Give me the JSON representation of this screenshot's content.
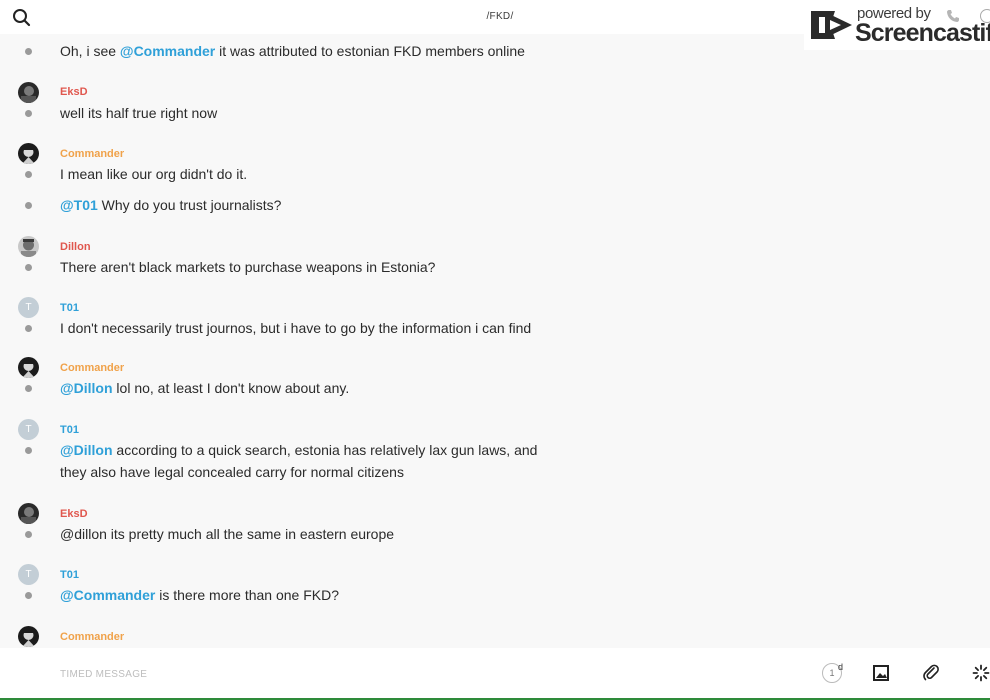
{
  "header": {
    "channel": "/FKD/",
    "search_icon": "search-icon"
  },
  "watermark": {
    "small": "powered by",
    "big": "Screencastify"
  },
  "messages": [
    {
      "text_before": "Oh, i see ",
      "mention": "@Commander",
      "text_after": "  it was attributed to estonian FKD members online"
    },
    {
      "user": "EksD",
      "text": "well its half true right now"
    },
    {
      "user": "Commander",
      "text": "I mean like our org didn't do it."
    },
    {
      "mention": "@T01",
      "text": " Why do you trust journalists?"
    },
    {
      "user": "Dillon",
      "text": "There aren't black markets to purchase weapons in Estonia?"
    },
    {
      "user": "T01",
      "avatar_letter": "T",
      "text": "I don't necessarily trust journos, but i have to go by the information i can find"
    },
    {
      "user": "Commander",
      "mention": "@Dillon",
      "text": " lol no, at least I don't know about any."
    },
    {
      "user": "T01",
      "avatar_letter": "T",
      "mention": "@Dillon",
      "text": " according to a quick search, estonia has relatively lax gun laws, and",
      "text_line2": "they also have legal concealed carry for normal citizens"
    },
    {
      "user": "EksD",
      "text": "@dillon its pretty much all the same in eastern europe"
    },
    {
      "user": "T01",
      "avatar_letter": "T",
      "mention": "@Commander",
      "text": "  is there more than one FKD?"
    },
    {
      "user": "Commander"
    }
  ],
  "composer": {
    "placeholder": "TIMED MESSAGE",
    "value": "",
    "timer_value": "1",
    "timer_unit": "d"
  },
  "colors": {
    "orange": "#f0a24a",
    "red": "#e0574e",
    "blue": "#2fa0d8",
    "dot": "#9a9a9a",
    "bottom_bar": "#2e8b3a"
  },
  "icons": [
    "search-icon",
    "image-icon",
    "paperclip-icon",
    "loading-spinner-icon",
    "screencastify-logo-icon",
    "phone-icon",
    "info-icon"
  ]
}
